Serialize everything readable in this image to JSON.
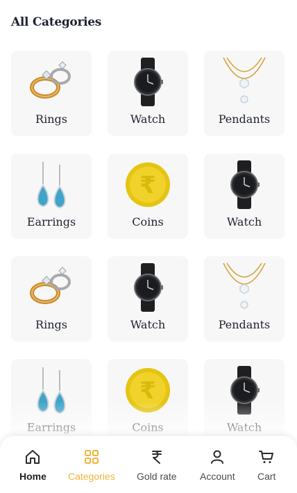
{
  "page": {
    "title": "All Categories"
  },
  "categories": [
    {
      "label": "Rings",
      "icon": "ring-icon"
    },
    {
      "label": "Watch",
      "icon": "watch-icon"
    },
    {
      "label": "Pendants",
      "icon": "pendant-icon"
    },
    {
      "label": "Earrings",
      "icon": "earring-icon"
    },
    {
      "label": "Coins",
      "icon": "coin-icon"
    },
    {
      "label": "Watch",
      "icon": "watch-icon"
    },
    {
      "label": "Rings",
      "icon": "ring-icon"
    },
    {
      "label": "Watch",
      "icon": "watch-icon"
    },
    {
      "label": "Pendants",
      "icon": "pendant-icon"
    },
    {
      "label": "Earrings",
      "icon": "earring-icon"
    },
    {
      "label": "Coins",
      "icon": "coin-icon"
    },
    {
      "label": "Watch",
      "icon": "watch-icon"
    }
  ],
  "bottom_nav": {
    "items": [
      {
        "label": "Home",
        "icon": "home-icon"
      },
      {
        "label": "Categories",
        "icon": "grid-icon",
        "active": true
      },
      {
        "label": "Gold rate",
        "icon": "rupee-icon"
      },
      {
        "label": "Account",
        "icon": "user-icon"
      },
      {
        "label": "Cart",
        "icon": "cart-icon"
      }
    ]
  },
  "colors": {
    "accent": "#f0b43a",
    "card_bg": "#f7f7f7",
    "text": "#1e2230"
  }
}
